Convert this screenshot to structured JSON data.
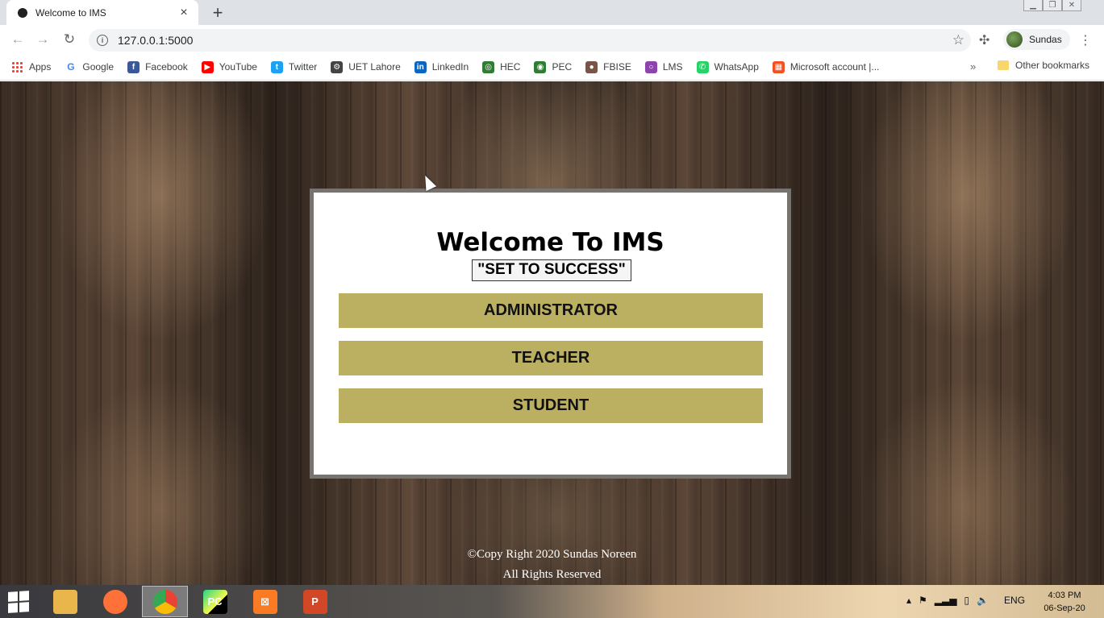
{
  "browser": {
    "tab_title": "Welcome to IMS",
    "new_tab_icon": "+",
    "close_icon": "×",
    "url": "127.0.0.1:5000",
    "profile_name": "Sundas",
    "bookmarks": [
      {
        "label": "Apps",
        "icon": "apps-grid-icon",
        "color": "#4285f4",
        "glyph": ""
      },
      {
        "label": "Google",
        "icon": "google-icon",
        "color": "#ffffff",
        "glyph": "G"
      },
      {
        "label": "Facebook",
        "icon": "facebook-icon",
        "color": "#3b5998",
        "glyph": "f"
      },
      {
        "label": "YouTube",
        "icon": "youtube-icon",
        "color": "#ff0000",
        "glyph": "▶"
      },
      {
        "label": "Twitter",
        "icon": "twitter-icon",
        "color": "#1da1f2",
        "glyph": "t"
      },
      {
        "label": "UET Lahore",
        "icon": "uet-icon",
        "color": "#444444",
        "glyph": "⚙"
      },
      {
        "label": "LinkedIn",
        "icon": "linkedin-icon",
        "color": "#0a66c2",
        "glyph": "in"
      },
      {
        "label": "HEC",
        "icon": "hec-icon",
        "color": "#2e7d32",
        "glyph": "◎"
      },
      {
        "label": "PEC",
        "icon": "pec-icon",
        "color": "#2e7d32",
        "glyph": "◉"
      },
      {
        "label": "FBISE",
        "icon": "fbise-icon",
        "color": "#795548",
        "glyph": "●"
      },
      {
        "label": "LMS",
        "icon": "lms-icon",
        "color": "#8e44ad",
        "glyph": "○"
      },
      {
        "label": "WhatsApp",
        "icon": "whatsapp-icon",
        "color": "#25d366",
        "glyph": "✆"
      },
      {
        "label": "Microsoft account |...",
        "icon": "microsoft-icon",
        "color": "#f25022",
        "glyph": "▦"
      }
    ],
    "more_bookmarks": "»",
    "other_bookmarks": "Other bookmarks"
  },
  "page": {
    "heading": "Welcome To IMS",
    "slogan": "\"SET TO SUCCESS\"",
    "roles": [
      "ADMINISTRATOR",
      "TEACHER",
      "STUDENT"
    ],
    "footer_line1": "©Copy Right 2020 Sundas Noreen",
    "footer_line2": "All Rights Reserved"
  },
  "taskbar": {
    "apps": [
      {
        "name": "file-explorer-icon",
        "color": "#e8b64a",
        "label": ""
      },
      {
        "name": "firefox-icon",
        "color": "#ff7139",
        "label": ""
      },
      {
        "name": "chrome-icon",
        "color": "#4285f4",
        "label": ""
      },
      {
        "name": "pycharm-icon",
        "color": "#21d789",
        "label": "PC"
      },
      {
        "name": "xampp-icon",
        "color": "#fb7a24",
        "label": "⊠"
      },
      {
        "name": "powerpoint-icon",
        "color": "#d24726",
        "label": "P"
      }
    ],
    "language": "ENG",
    "time": "4:03 PM",
    "date": "06-Sep-20"
  },
  "colors": {
    "button_bg": "#bbb062",
    "card_border": "#77736f"
  }
}
